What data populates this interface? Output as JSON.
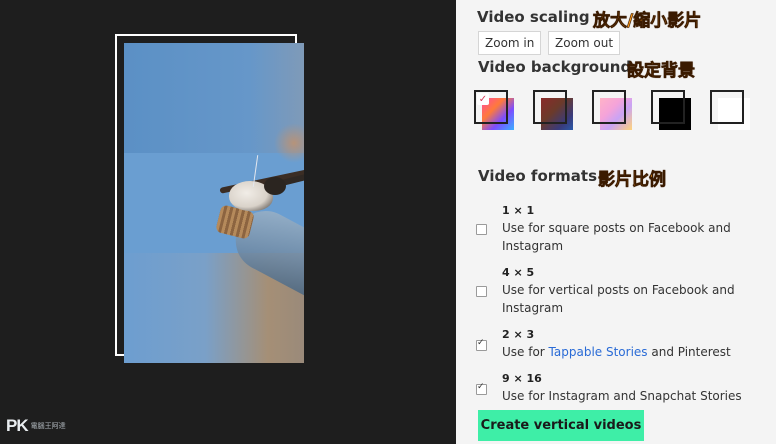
{
  "scaling": {
    "title": "Video scaling",
    "tag": "放大/縮小影片",
    "zoom_in": "Zoom in",
    "zoom_out": "Zoom out"
  },
  "background": {
    "title": "Video background",
    "tag": "設定背景"
  },
  "formats": {
    "title": "Video formats",
    "tag": "影片比例",
    "items": [
      {
        "ratio": "1 × 1",
        "desc": "Use for square posts on Facebook and Instagram",
        "checked": false
      },
      {
        "ratio": "4 × 5",
        "desc": "Use for vertical posts on Facebook and Instagram",
        "checked": false
      },
      {
        "ratio": "2 × 3",
        "desc_pre": "Use for ",
        "link": "Tappable Stories",
        "desc_post": " and Pinterest",
        "checked": true
      },
      {
        "ratio": "9 × 16",
        "desc": "Use for Instagram and Snapchat Stories",
        "checked": true
      }
    ]
  },
  "create_button": "Create vertical videos",
  "logo": {
    "text": "PK",
    "sub": "電腦王阿達"
  },
  "colors": {
    "accent": "#3eeea7",
    "tag": "#ff9a1a",
    "link": "#2a6bd6"
  }
}
